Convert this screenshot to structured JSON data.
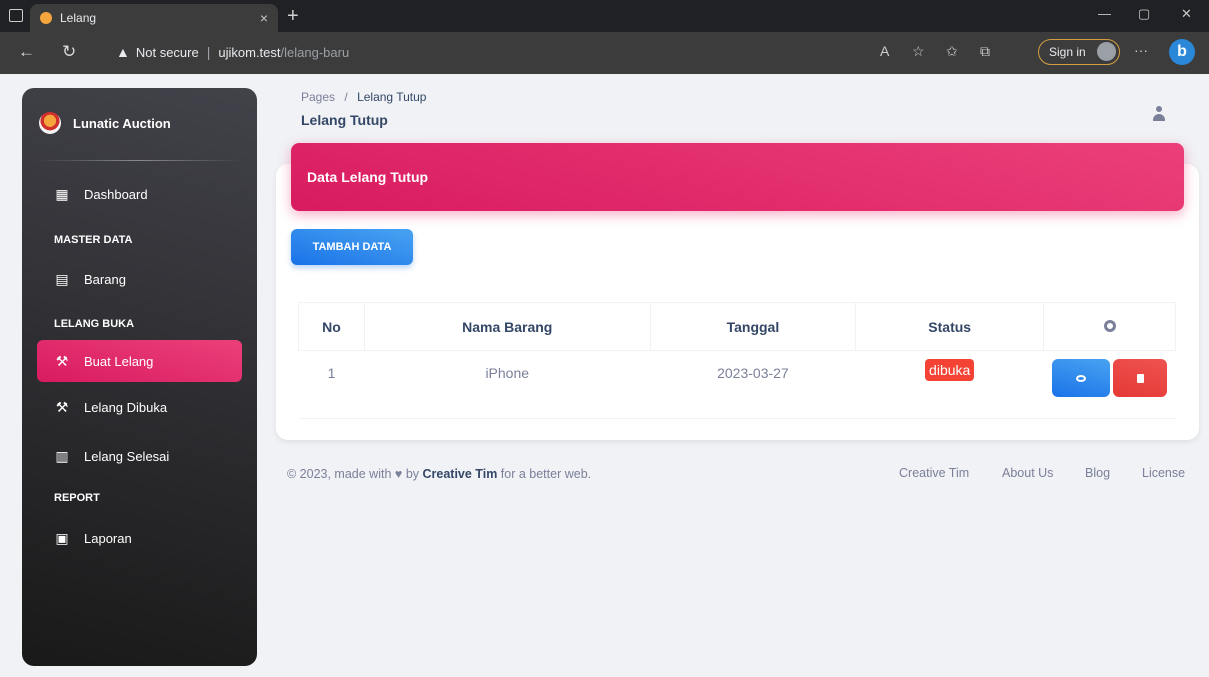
{
  "browser": {
    "tab_title": "Lelang",
    "tab_close": "×",
    "new_tab": "+",
    "security_label": "Not secure",
    "separator": "|",
    "url_host": "ujikom.test",
    "url_path": "/lelang-baru",
    "signin_label": "Sign in",
    "more": "···",
    "bing": "b",
    "window_controls": [
      "—",
      "▢",
      "✕"
    ]
  },
  "sidebar": {
    "brand": "Lunatic Auction",
    "dashboard": "Dashboard",
    "sections": {
      "master": "MASTER DATA",
      "lelang": "LELANG BUKA",
      "report": "REPORT"
    },
    "items": {
      "barang": "Barang",
      "buat_lelang": "Buat Lelang",
      "lelang_dibuka": "Lelang Dibuka",
      "lelang_selesai": "Lelang Selesai",
      "laporan": "Laporan"
    }
  },
  "header": {
    "breadcrumb_root": "Pages",
    "breadcrumb_sep": "/",
    "breadcrumb_current": "Lelang Tutup",
    "title": "Lelang Tutup"
  },
  "card": {
    "title": "Data Lelang Tutup",
    "add_button": "TAMBAH DATA"
  },
  "table": {
    "columns": [
      "No",
      "Nama Barang",
      "Tanggal",
      "Status"
    ],
    "rows": [
      {
        "no": "1",
        "nama": "iPhone",
        "tanggal": "2023-03-27",
        "status": "dibuka"
      }
    ]
  },
  "footer": {
    "prefix": "© 2023, made with",
    "by": "by",
    "author": "Creative Tim",
    "suffix": "for a better web.",
    "links": [
      "Creative Tim",
      "About Us",
      "Blog",
      "License"
    ]
  },
  "colors": {
    "primary": "#e91e63",
    "info": "#1a73e8",
    "danger": "#f44335",
    "sidebar_dark": "#191919"
  }
}
